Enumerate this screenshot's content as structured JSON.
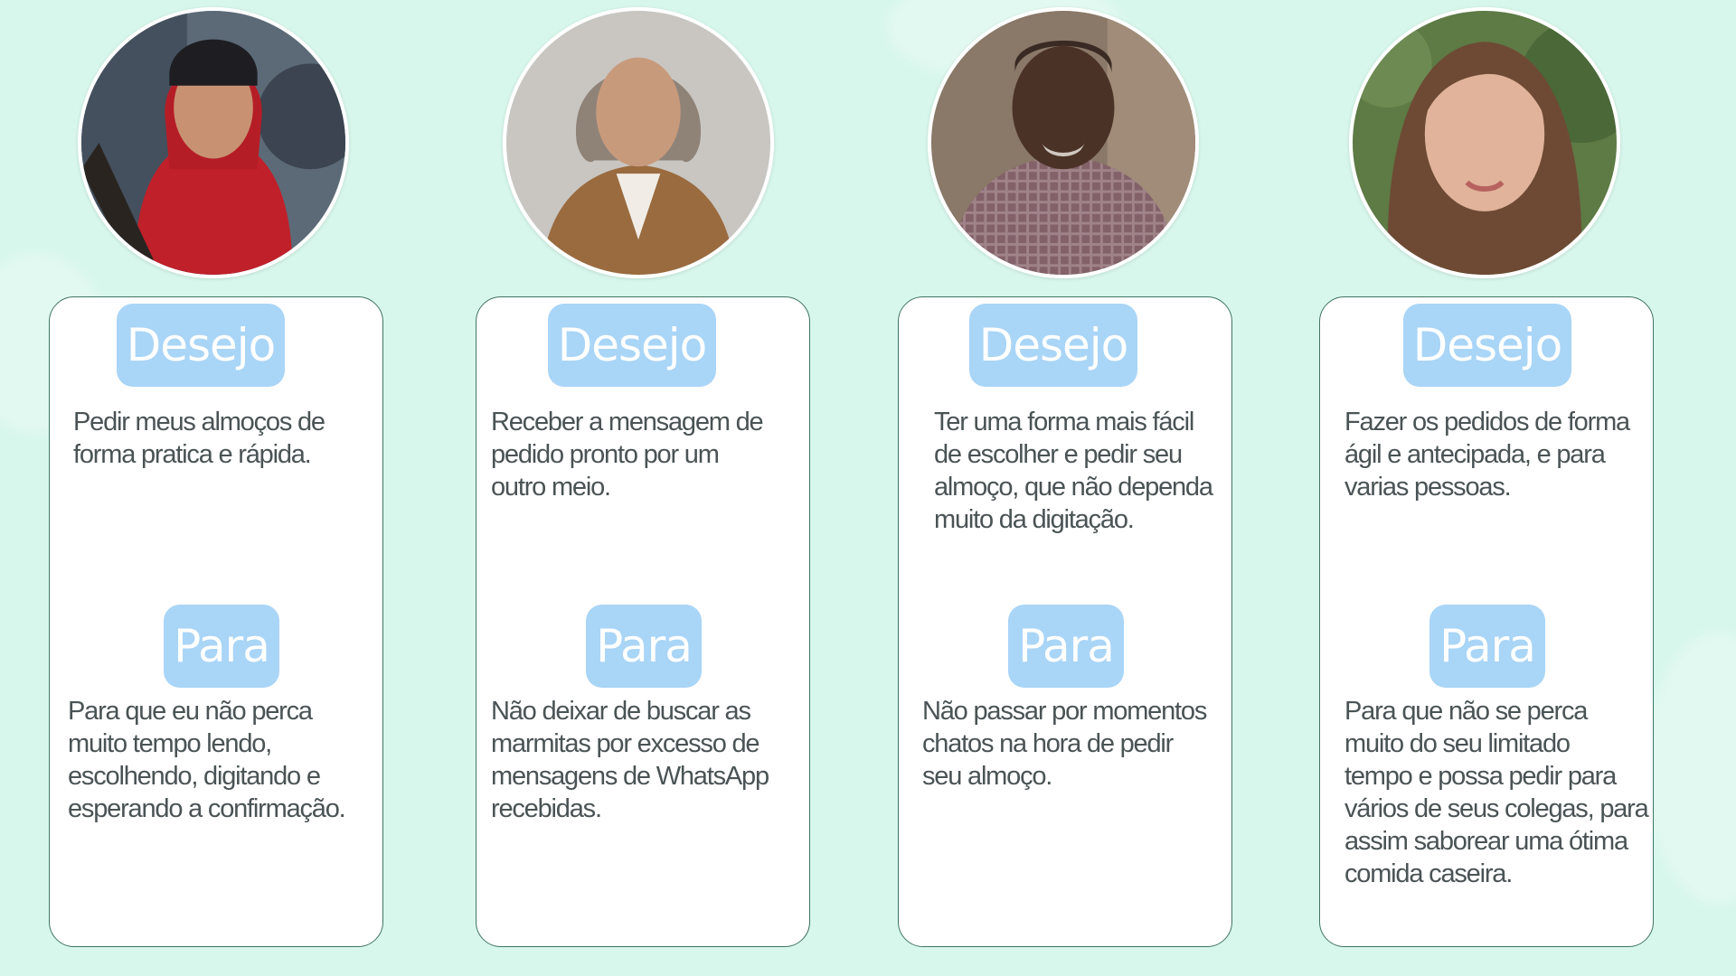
{
  "personas": [
    {
      "desejo_label": "Desejo",
      "desejo_text": "Pedir meus almoços de\nforma pratica e rápida.",
      "para_label": "Para",
      "para_text": "Para que eu não perca\nmuito tempo lendo,\nescolhendo, digitando e\nesperando a confirmação."
    },
    {
      "desejo_label": "Desejo",
      "desejo_text": "Receber a mensagem de\npedido pronto por um\noutro meio.",
      "para_label": "Para",
      "para_text": "Não deixar de buscar as\nmarmitas por excesso de\nmensagens de WhatsApp\nrecebidas."
    },
    {
      "desejo_label": "Desejo",
      "desejo_text": "Ter uma forma mais fácil\nde escolher e pedir seu\nalmoço, que não dependa\nmuito da digitação.",
      "para_label": "Para",
      "para_text": "Não passar por momentos\nchatos na hora de pedir\nseu almoço."
    },
    {
      "desejo_label": "Desejo",
      "desejo_text": "Fazer os pedidos de forma\nágil e antecipada, e para\nvarias pessoas.",
      "para_label": "Para",
      "para_text": "Para que não se perca\nmuito do seu limitado\ntempo e possa pedir para\nvários de seus colegas, para\nassim saborear uma ótima\ncomida caseira."
    }
  ],
  "colors": {
    "background": "#d8f7ec",
    "pill": "#a9d5f7",
    "card_border": "#3f7561",
    "text": "#4a5355"
  },
  "icons": [
    "persona-photo-young-man-red-hoodie",
    "persona-photo-older-woman",
    "persona-photo-man-plaid-shirt",
    "persona-photo-young-woman"
  ]
}
